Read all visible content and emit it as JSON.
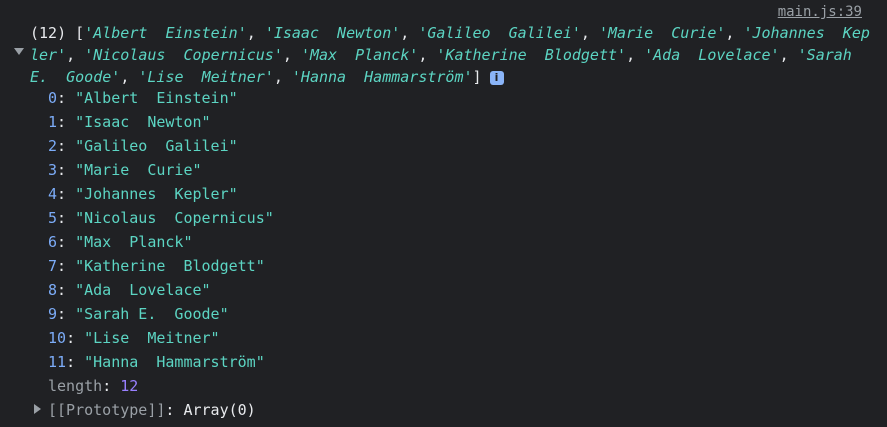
{
  "source_link": "main.js:39",
  "summary": {
    "count": "(12)",
    "open_bracket": "[",
    "close_bracket": "]",
    "items": [
      "'Albert  Einstein'",
      "'Isaac  Newton'",
      "'Galileo  Galilei'",
      "'Marie  Curie'",
      "'Johannes  Kepler'",
      "'Nicolaus  Copernicus'",
      "'Max  Planck'",
      "'Katherine  Blodgett'",
      "'Ada  Lovelace'",
      "'Sarah E.  Goode'",
      "'Lise  Meitner'",
      "'Hanna  Hammarström'"
    ],
    "info_badge": "i"
  },
  "entries": [
    {
      "key": "0",
      "value": "\"Albert  Einstein\""
    },
    {
      "key": "1",
      "value": "\"Isaac  Newton\""
    },
    {
      "key": "2",
      "value": "\"Galileo  Galilei\""
    },
    {
      "key": "3",
      "value": "\"Marie  Curie\""
    },
    {
      "key": "4",
      "value": "\"Johannes  Kepler\""
    },
    {
      "key": "5",
      "value": "\"Nicolaus  Copernicus\""
    },
    {
      "key": "6",
      "value": "\"Max  Planck\""
    },
    {
      "key": "7",
      "value": "\"Katherine  Blodgett\""
    },
    {
      "key": "8",
      "value": "\"Ada  Lovelace\""
    },
    {
      "key": "9",
      "value": "\"Sarah E.  Goode\""
    },
    {
      "key": "10",
      "value": "\"Lise  Meitner\""
    },
    {
      "key": "11",
      "value": "\"Hanna  Hammarström\""
    }
  ],
  "length": {
    "key": "length",
    "value": "12"
  },
  "prototype": {
    "key": "[[Prototype]]",
    "value": "Array(0)"
  },
  "colors": {
    "background": "#202124",
    "string": "#5cd5c3",
    "key": "#7cacf8",
    "number": "#9980ff",
    "muted": "#9aa0a6"
  }
}
